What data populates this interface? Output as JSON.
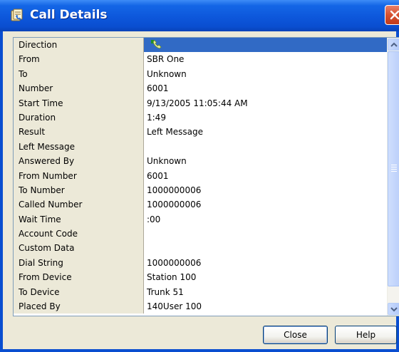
{
  "window": {
    "title": "Call Details",
    "icon": "call-details-icon",
    "close_icon": "close-x-icon"
  },
  "details": [
    {
      "label": "Direction",
      "value": "",
      "icon": "call-direction-icon",
      "selected": true
    },
    {
      "label": "From",
      "value": "SBR One"
    },
    {
      "label": "To",
      "value": "Unknown"
    },
    {
      "label": "Number",
      "value": "6001"
    },
    {
      "label": "Start Time",
      "value": "9/13/2005 11:05:44 AM"
    },
    {
      "label": "Duration",
      "value": "1:49"
    },
    {
      "label": "Result",
      "value": "Left Message"
    },
    {
      "label": "Left Message",
      "value": ""
    },
    {
      "label": "Answered By",
      "value": "Unknown"
    },
    {
      "label": "From Number",
      "value": "6001"
    },
    {
      "label": "To Number",
      "value": "1000000006"
    },
    {
      "label": "Called Number",
      "value": "1000000006"
    },
    {
      "label": "Wait Time",
      "value": ":00"
    },
    {
      "label": "Account Code",
      "value": ""
    },
    {
      "label": "Custom Data",
      "value": ""
    },
    {
      "label": "Dial String",
      "value": "1000000006"
    },
    {
      "label": "From Device",
      "value": "Station 100"
    },
    {
      "label": "To Device",
      "value": "Trunk 51"
    },
    {
      "label": "Placed By",
      "value": "140User 100"
    }
  ],
  "buttons": {
    "close_label": "Close",
    "help_label": "Help"
  },
  "colors": {
    "titlebar": "#0A4ED0",
    "selection": "#316AC5",
    "label_background": "#ECE9D8"
  }
}
